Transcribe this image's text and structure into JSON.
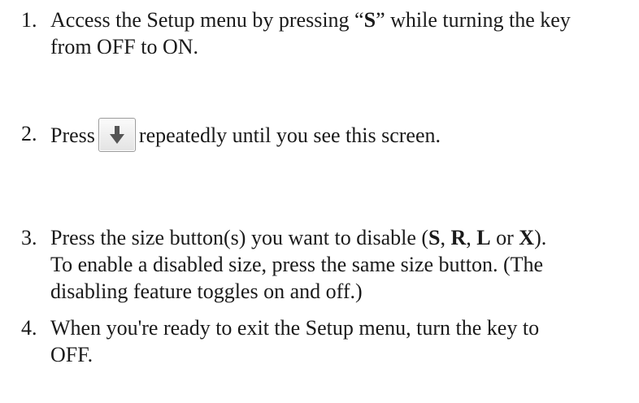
{
  "steps": [
    {
      "number": "1.",
      "line1_part1": "Access the Setup menu by pressing “",
      "line1_bold": "S",
      "line1_part2": "” while turning the key",
      "line2": "from OFF to ON."
    },
    {
      "number": "2.",
      "before_button": "Press",
      "button_icon": "down-arrow-icon",
      "after_button": "repeatedly until you see this screen."
    },
    {
      "number": "3.",
      "line1_part1": "Press the size button(s) you want to disable (",
      "bold_s": "S",
      "sep1": ", ",
      "bold_r": "R",
      "sep2": ", ",
      "bold_l": "L",
      "sep3": " or ",
      "bold_x": "X",
      "line1_end": ").",
      "line2": "To enable a disabled size, press the same size button. (The",
      "line3": "disabling feature toggles on and off.)"
    },
    {
      "number": "4.",
      "line1": "When you're ready to exit the Setup menu, turn the key to",
      "line2": "OFF."
    }
  ],
  "colors": {
    "text": "#1a1a1a",
    "button_border": "#9a9a9a",
    "arrow": "#555555"
  }
}
